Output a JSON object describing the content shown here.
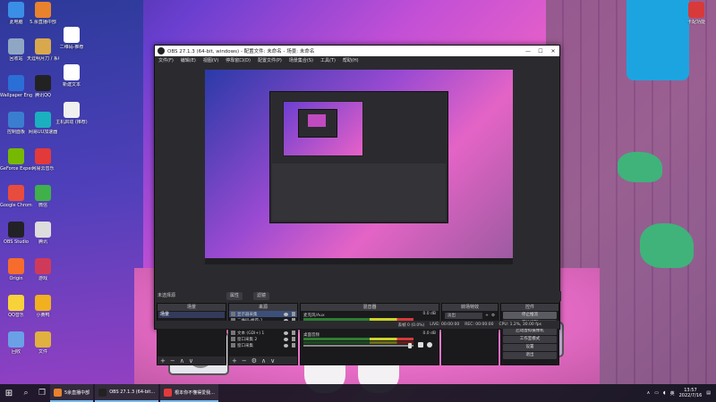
{
  "desktop_icons_left": [
    {
      "label": "此电脑",
      "color": "#3a8ee6"
    },
    {
      "label": "回收站",
      "color": "#8fa7c4"
    },
    {
      "label": "Wallpaper Engine",
      "color": "#2a6fd6"
    },
    {
      "label": "控制面板",
      "color": "#3a7ed0"
    },
    {
      "label": "GeForce Experience",
      "color": "#76b900"
    },
    {
      "label": "Google Chrome",
      "color": "#e84c3d"
    },
    {
      "label": "OBS Studio",
      "color": "#222226"
    },
    {
      "label": "Origin",
      "color": "#f56c2d"
    },
    {
      "label": "QQ音乐",
      "color": "#f7d23a"
    },
    {
      "label": "回收",
      "color": "#6aa0e6"
    }
  ],
  "desktop_icons_col2": [
    {
      "label": "5.余直播中部",
      "color": "#e8822d"
    },
    {
      "label": "天涯明月刀 / 系统",
      "color": "#d9a84c"
    },
    {
      "label": "腾讯QQ",
      "color": "#222"
    },
    {
      "label": "网易UU加速器",
      "color": "#1ab0c0"
    },
    {
      "label": "网易云音乐",
      "color": "#e23a3a"
    },
    {
      "label": "微信",
      "color": "#3fb04a"
    },
    {
      "label": "腾讯",
      "color": "#ddd"
    },
    {
      "label": "游戏",
      "color": "#d03a5a"
    },
    {
      "label": "小黄鸭",
      "color": "#f0b020"
    },
    {
      "label": "文件",
      "color": "#e0b040"
    }
  ],
  "desktop_icons_col3": [
    {
      "label": "二维码-推荐",
      "color": "#ffffff"
    },
    {
      "label": "新建文本",
      "color": "#ffffff"
    },
    {
      "label": "主机启动 (推荐)",
      "color": "#f0f0f0"
    }
  ],
  "desktop_icon_right": {
    "label": "卡配功能",
    "color": "#d83a3a"
  },
  "obs": {
    "title": "OBS 27.1.3 (64-bit, windows) - 配置文件: 未命名 - 场景: 未命名",
    "menu": [
      "文件(F)",
      "编辑(E)",
      "视图(V)",
      "停靠窗口(D)",
      "配置文件(P)",
      "场景集合(S)",
      "工具(T)",
      "帮助(H)"
    ],
    "scene_bar_label": "未选择源",
    "tabs": {
      "props": "属性",
      "filters": "滤镜"
    },
    "docks": {
      "scenes": {
        "title": "场景",
        "items": [
          "场景"
        ]
      },
      "sources": {
        "title": "来源",
        "items": [
          "显示器采集",
          "二维码-推荐-1",
          "二维码-推荐-2",
          "文本 (GDI+) 1",
          "窗口采集 2",
          "窗口采集"
        ]
      },
      "mixer": {
        "title": "混音器",
        "tracks": [
          {
            "name": "麦克风/Aux",
            "db": "0.0 dB"
          },
          {
            "name": "桌面音频",
            "db": "0.0 dB"
          }
        ]
      },
      "transitions": {
        "title": "转场特效",
        "type": "淡出",
        "duration_label": "时长",
        "duration": "300 ms"
      },
      "controls": {
        "title": "控件",
        "buttons": [
          "停止推流",
          "开始录制",
          "启动虚拟摄像机",
          "工作室模式",
          "设置",
          "退出"
        ]
      }
    },
    "status": {
      "dropped": "丢帧 0 (0.0%)",
      "live": "LIVE: 00:00:00",
      "rec": "REC: 00:00:00",
      "cpu": "CPU: 1.2%, 30.00 fps"
    }
  },
  "taskbar": {
    "apps": [
      {
        "label": "5余直播中部",
        "color": "#e8822d"
      },
      {
        "label": "OBS 27.1.3 (64-bit...",
        "color": "#222"
      },
      {
        "label": "根本你不懂得爱我...",
        "color": "#e23a3a"
      }
    ],
    "tray_lang": "英",
    "time": "13:57",
    "date": "2022/7/16"
  }
}
